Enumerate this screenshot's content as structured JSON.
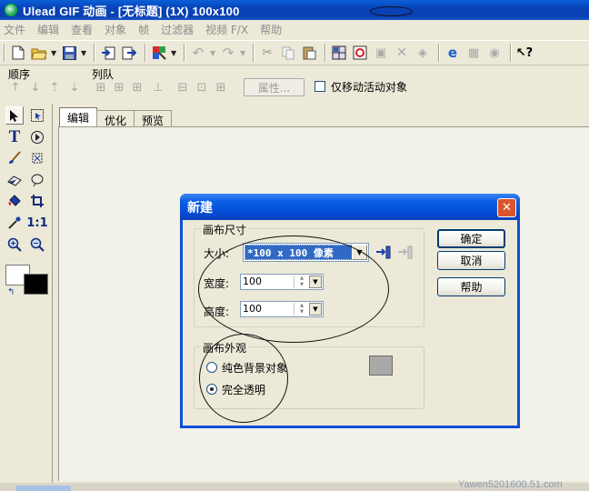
{
  "window": {
    "title": "Ulead GIF 动画 - [无标题] (1X) 100x100"
  },
  "menu": [
    "文件",
    "编辑",
    "查看",
    "对象",
    "帧",
    "过滤器",
    "视频 F/X",
    "帮助"
  ],
  "arrange": {
    "order_label": "顺序",
    "align_label": "列队",
    "attributes_button": "属性...",
    "move_active_only": "仅移动活动对象"
  },
  "tools": [
    "arrow-select",
    "marquee-select",
    "text",
    "transform",
    "brush",
    "lasso",
    "eraser",
    "ellipse-select",
    "fill",
    "crop",
    "eyedropper",
    "actual-size",
    "zoom-in",
    "zoom-out"
  ],
  "colors": {
    "foreground": "#ffffff",
    "background": "#000000"
  },
  "tabs": [
    {
      "label": "编辑",
      "active": true
    },
    {
      "label": "优化",
      "active": false
    },
    {
      "label": "预览",
      "active": false
    }
  ],
  "dialog": {
    "title": "新建",
    "canvas_size_group": "画布尺寸",
    "size_label": "大小:",
    "size_value": "*100 x 100 像素",
    "width_label": "宽度:",
    "width_value": "100",
    "height_label": "高度:",
    "height_value": "100",
    "appearance_group": "画布外观",
    "solid_bg_label": "纯色背景对象",
    "transparent_label": "完全透明",
    "selected_appearance": "完全透明",
    "swatch_color": "#a9a9a9",
    "ok_button": "确定",
    "cancel_button": "取消",
    "help_button": "帮助"
  },
  "watermark": "Yawen5201600.51.com"
}
